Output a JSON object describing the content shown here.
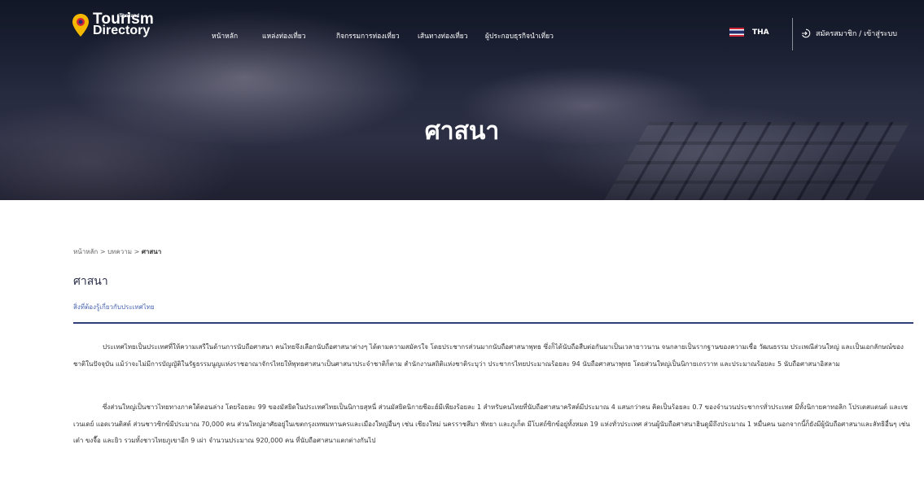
{
  "header": {
    "logo": {
      "line1": "Tourism",
      "line2": "Directory",
      "badge": "ᵒThailand"
    },
    "nav": [
      {
        "label": "หน้าหลัก"
      },
      {
        "label": "แหล่งท่องเที่ยว"
      },
      {
        "label": "กิจกรรมการท่องเที่ยว"
      },
      {
        "label": "เส้นทางท่องเที่ยว"
      },
      {
        "label": "ผู้ประกอบธุรกิจนำเที่ยว"
      }
    ],
    "language": "THA",
    "login": "สมัครสมาชิก / เข้าสู่ระบบ"
  },
  "hero": {
    "title": "ศาสนา"
  },
  "breadcrumb": {
    "home": "หน้าหลัก",
    "sep1": ">",
    "articles": "บทความ",
    "sep2": ">",
    "current": "ศาสนา"
  },
  "article": {
    "title": "ศาสนา",
    "subtitle": "สิ่งที่ต้องรู้เกี่ยวกับประเทศไทย",
    "paragraph1": "ประเทศไทยเป็นประเทศที่ให้ความเสรีในด้านการนับถือศาสนา คนไทยจึงเลือกนับถือศาสนาต่างๆ ได้ตามความสมัครใจ โดยประชากรส่วนมากนับถือศาสนาพุทธ ซึ่งก็ได้นับถือสืบต่อกันมาเป็นเวลายาวนาน จนกลายเป็นรากฐานของความเชื่อ วัฒนธรรม ประเพณีส่วนใหญ่ และเป็นเอกลักษณ์ของชาติในปัจจุบัน แม้ว่าจะไม่มีการบัญญัติในรัฐธรรมนูญแห่งราชอาณาจักรไทยให้พุทธศาสนาเป็นศาสนาประจำชาติก็ตาม สำนักงานสถิติแห่งชาติระบุว่า ประชากรไทยประมาณร้อยละ 94 นับถือศาสนาพุทธ โดยส่วนใหญ่เป็นนิกายเถรวาท และประมาณร้อยละ 5 นับถือศาสนาอิสลาม",
    "paragraph2": "ซึ่งส่วนใหญ่เป็นชาวไทยทางภาคใต้ตอนล่าง โดยร้อยละ 99 ของมัสยิดในประเทศไทยเป็นนิกายสุหนี่ ส่วนมัสยิดนิกายชีอะฮ์มีเพียงร้อยละ 1 สำหรับคนไทยที่นับถือศาสนาคริสต์มีประมาณ 4 แสนกว่าคน คิดเป็นร้อยละ 0.7 ของจำนวนประชากรทั่วประเทศ มีทั้งนิกายคาทอลิก โปรเตสแตนต์ และเซเวนเดย์ แอดเวนติสต์ ส่วนชาวซิกข์มีประมาณ 70,000 คน ส่วนใหญ่อาศัยอยู่ในเขตกรุงเทพมหานครและเมืองใหญ่อื่นๆ เช่น เชียงใหม่ นครราชสีมา พัทยา และภูเก็ต มีโบสถ์ซิกข์อยู่ทั้งหมด 19 แห่งทั่วประเทศ ส่วนผู้นับถือศาสนาฮินดูมีถึงประมาณ 1 หมื่นคน นอกจากนี้ก็ยังมีผู้นับถือศาสนาและลัทธิอื่นๆ เช่น เต๋า ขงจื๊อ และยิว รวมทั้งชาวไทยภูเขาอีก 9 เผ่า จำนวนประมาณ 920,000 คน ที่นับถือศาสนาแตกต่างกันไป"
  },
  "colors": {
    "accent": "#2e3f7a",
    "link": "#4a65b0",
    "logo_pin": "#f5b800"
  }
}
